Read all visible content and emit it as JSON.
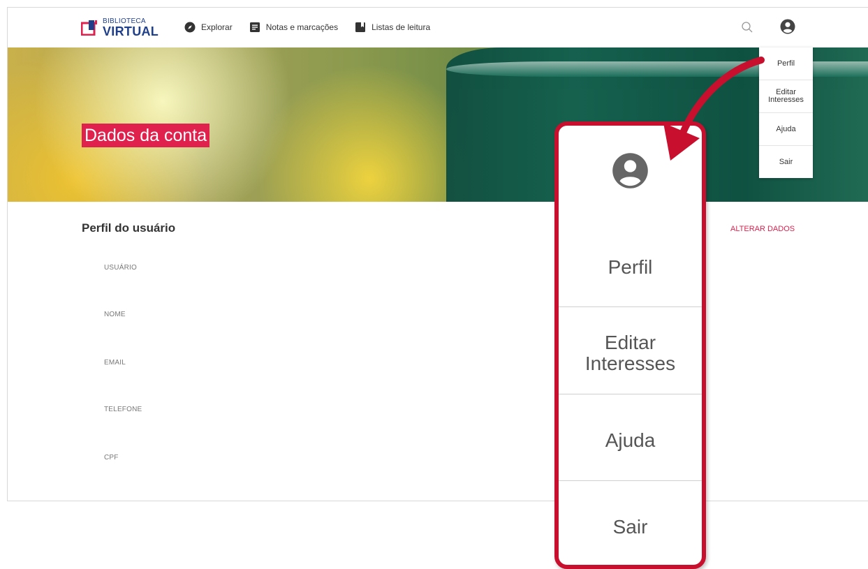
{
  "brand": {
    "line1": "BIBLIOTECA",
    "line2": "VIRTUAL"
  },
  "nav": {
    "items": [
      {
        "label": "Explorar",
        "icon": "compass-icon"
      },
      {
        "label": "Notas e marcações",
        "icon": "notes-icon"
      },
      {
        "label": "Listas de leitura",
        "icon": "bookmark-icon"
      }
    ]
  },
  "header": {
    "search_icon": "search-icon",
    "user_icon": "account-circle-icon"
  },
  "hero": {
    "title": "Dados da conta"
  },
  "dropdown": {
    "items": [
      "Perfil",
      "Editar Interesses",
      "Ajuda",
      "Sair"
    ]
  },
  "profile": {
    "title": "Perfil do usuário",
    "edit_label": "ALTERAR DADOS",
    "fields": [
      "USUÁRIO",
      "NOME",
      "EMAIL",
      "TELEFONE",
      "CPF"
    ]
  },
  "callout": {
    "items": [
      "Perfil",
      "Editar Interesses",
      "Ajuda",
      "Sair"
    ]
  },
  "colors": {
    "accent": "#e0204d",
    "callout_border": "#c8102e",
    "brand_blue": "#1f3f8a"
  }
}
